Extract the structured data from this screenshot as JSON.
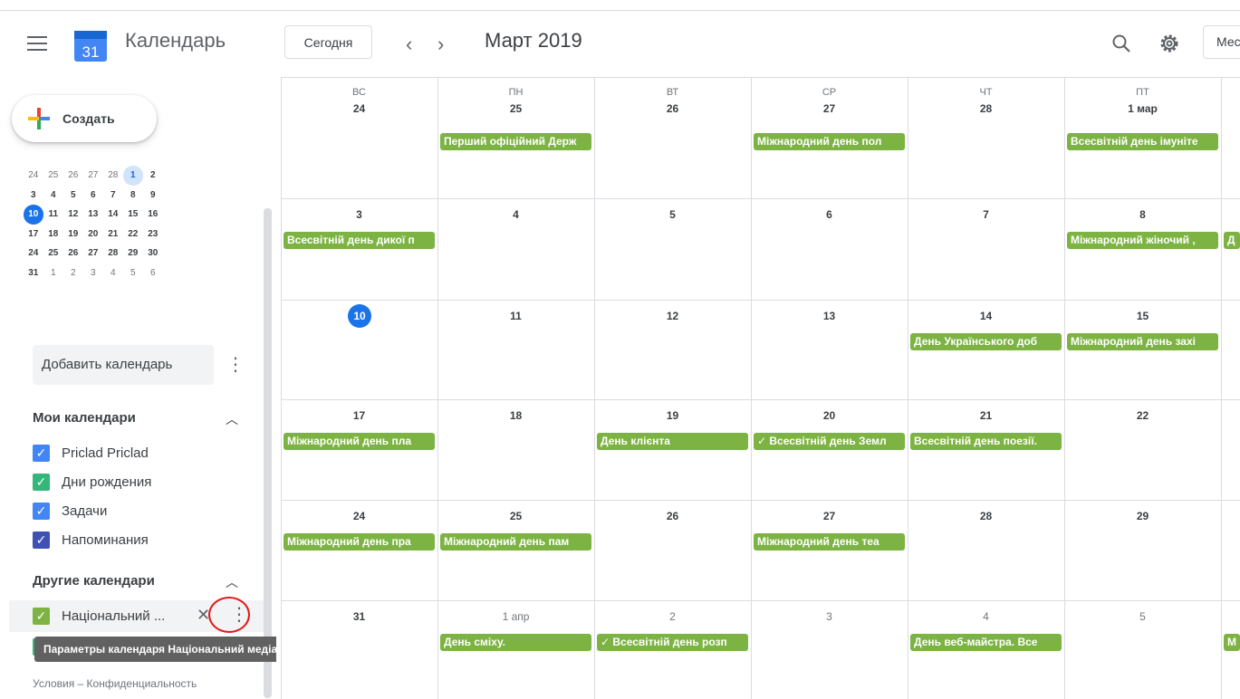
{
  "header": {
    "app_title": "Календарь",
    "today_label": "Сегодня",
    "prev": "‹",
    "next": "›",
    "month_title": "Март 2019",
    "view_label": "Месяц",
    "logo_day": "31"
  },
  "sidebar": {
    "create_label": "Создать",
    "mini_calendar": [
      [
        "24",
        "25",
        "26",
        "27",
        "28",
        "1",
        "2"
      ],
      [
        "3",
        "4",
        "5",
        "6",
        "7",
        "8",
        "9"
      ],
      [
        "10",
        "11",
        "12",
        "13",
        "14",
        "15",
        "16"
      ],
      [
        "17",
        "18",
        "19",
        "20",
        "21",
        "22",
        "23"
      ],
      [
        "24",
        "25",
        "26",
        "27",
        "28",
        "29",
        "30"
      ],
      [
        "31",
        "1",
        "2",
        "3",
        "4",
        "5",
        "6"
      ]
    ],
    "add_calendar_placeholder": "Добавить календарь",
    "my_calendars_title": "Мои календари",
    "my_calendars": [
      {
        "name": "Priclad Priclad",
        "color": "#4285f4"
      },
      {
        "name": "Дни рождения",
        "color": "#33b679"
      },
      {
        "name": "Задачи",
        "color": "#4285f4"
      },
      {
        "name": "Напоминания",
        "color": "#3f51b5"
      }
    ],
    "other_calendars_title": "Другие календари",
    "other_calendars": [
      {
        "name": "Національний ...",
        "color": "#7cb342"
      }
    ],
    "tooltip": "Параметры календаря Національний медіаосвітній календар",
    "footer": "Условия – Конфиденциальность"
  },
  "grid": {
    "weekdays": [
      "ВС",
      "ПН",
      "ВТ",
      "СР",
      "ЧТ",
      "ПТ"
    ],
    "weeks": [
      [
        "24",
        "25",
        "26",
        "27",
        "28",
        "1 мар"
      ],
      [
        "3",
        "4",
        "5",
        "6",
        "7",
        "8"
      ],
      [
        "10",
        "11",
        "12",
        "13",
        "14",
        "15"
      ],
      [
        "17",
        "18",
        "19",
        "20",
        "21",
        "22"
      ],
      [
        "24",
        "25",
        "26",
        "27",
        "28",
        "29"
      ],
      [
        "31",
        "1 апр",
        "2",
        "3",
        "4",
        "5"
      ]
    ],
    "events": {
      "w0d1": "Перший офіційний Держ",
      "w0d3": "Міжнародний день пол",
      "w0d5": "Всесвітній день імуніте",
      "w1d0": "Всесвітній день дикої п",
      "w1d5": "Міжнародний жіночий ,",
      "w2d4": "День Українського доб",
      "w2d5": "Міжнародний день захі",
      "w3d0": "Міжнародний день пла",
      "w3d2": "День клієнта",
      "w3d3": "✓ Всесвітній день Земл",
      "w3d4": "Всесвітній день поезії.",
      "w4d0": "Міжнародний день пра",
      "w4d1": "Міжнародний день пам",
      "w4d3": "Міжнародний день теа",
      "w5d1": "День сміху.",
      "w5d2": "✓ Всесвітній день розп",
      "w5d4": "День веб-майстра. Все",
      "edge_w1": "Д",
      "edge_w5": "М"
    },
    "event_color": "#7cb342",
    "today_color": "#1a73e8"
  }
}
